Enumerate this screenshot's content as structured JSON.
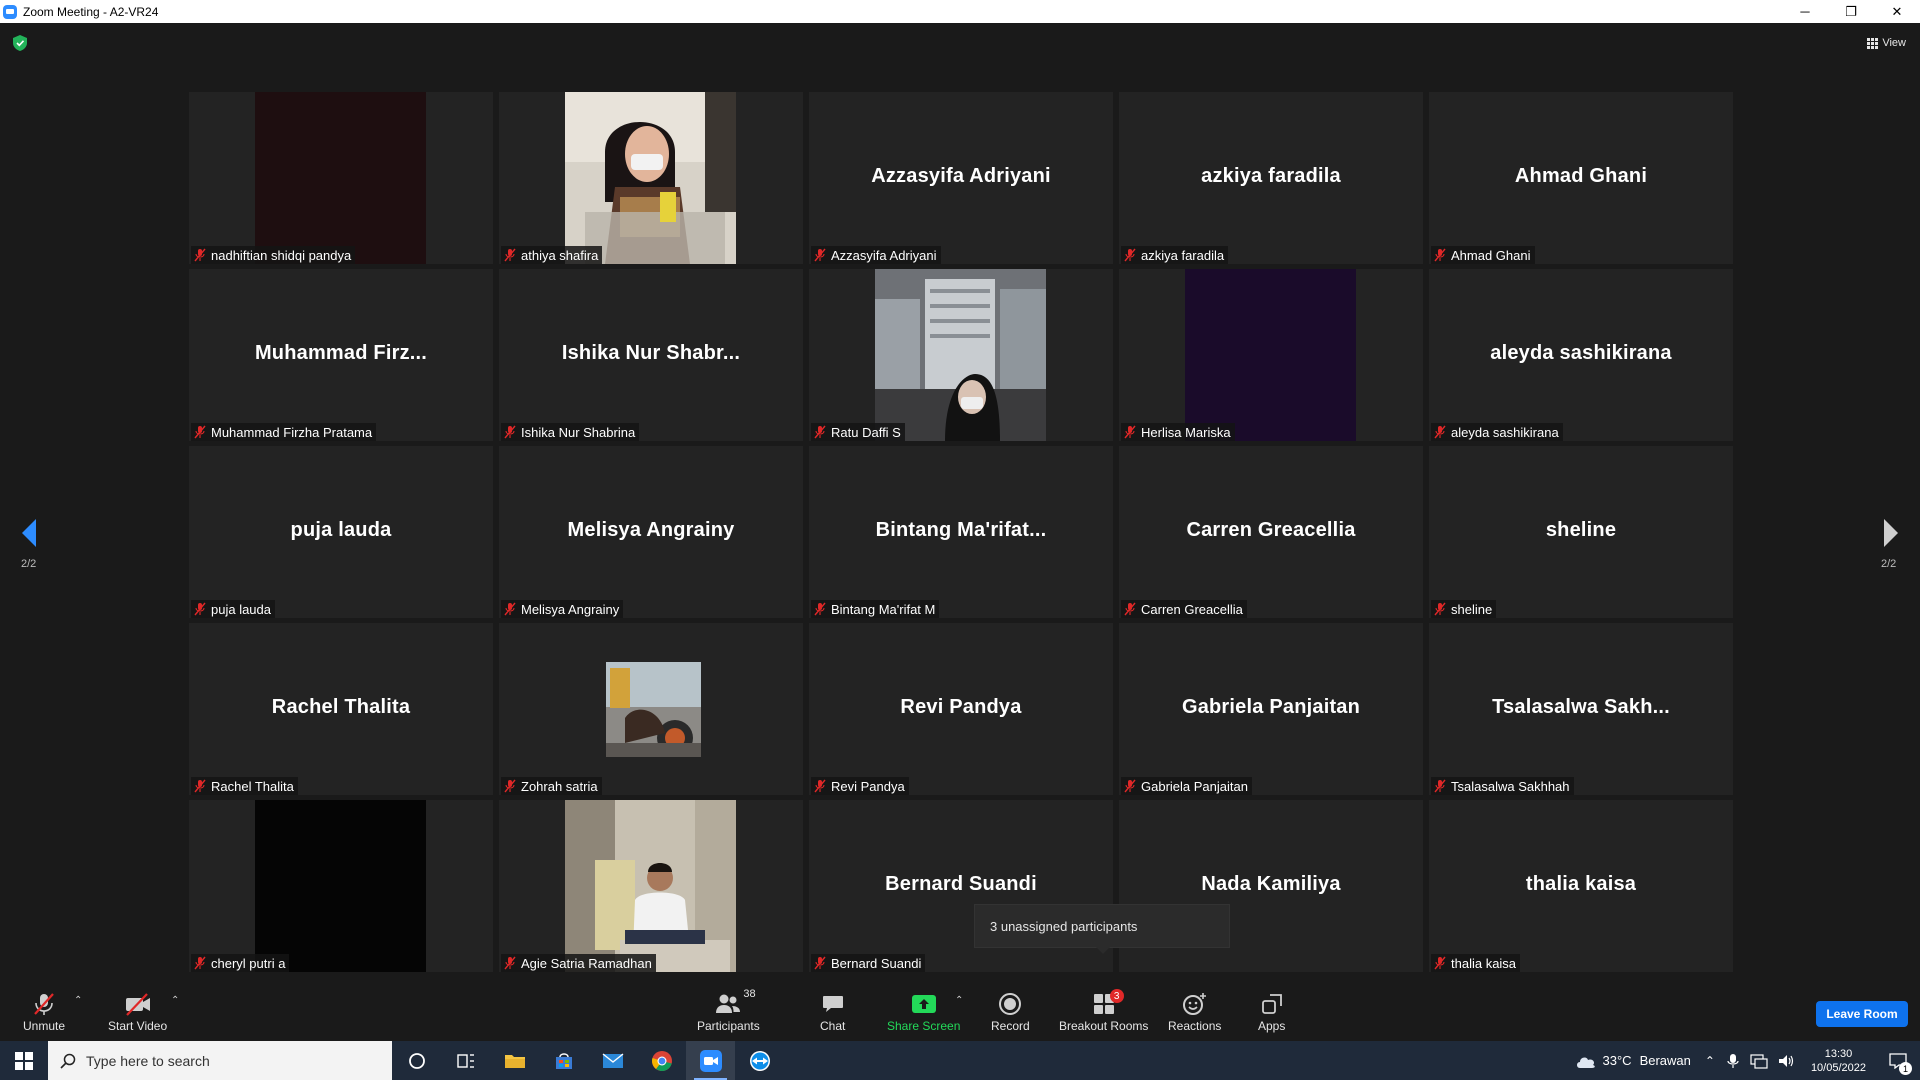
{
  "window": {
    "title": "Zoom Meeting - A2-VR24",
    "minimize": "─",
    "maximize": "❐",
    "close": "✕"
  },
  "header": {
    "view_label": "View"
  },
  "pagination": {
    "left": "2/2",
    "right": "2/2"
  },
  "participants": [
    {
      "name": "nadhiftian shidqi pandya",
      "display": "",
      "video": "dark"
    },
    {
      "name": "athiya shafira",
      "display": "",
      "video": "person"
    },
    {
      "name": "Azzasyifa Adriyani",
      "display": "Azzasyifa Adriyani",
      "video": "none"
    },
    {
      "name": "azkiya faradila",
      "display": "azkiya faradila",
      "video": "none"
    },
    {
      "name": "Ahmad Ghani",
      "display": "Ahmad Ghani",
      "video": "none"
    },
    {
      "name": "Muhammad Firzha Pratama",
      "display": "Muhammad  Firz...",
      "video": "none"
    },
    {
      "name": "Ishika Nur Shabrina",
      "display": "Ishika  Nur  Shabr...",
      "video": "none"
    },
    {
      "name": "Ratu Daffi S",
      "display": "",
      "video": "city"
    },
    {
      "name": "Herlisa Mariska",
      "display": "",
      "video": "purple"
    },
    {
      "name": "aleyda sashikirana",
      "display": "aleyda sashikirana",
      "video": "none"
    },
    {
      "name": "puja lauda",
      "display": "puja lauda",
      "video": "none"
    },
    {
      "name": "Melisya Angrainy",
      "display": "Melisya Angrainy",
      "video": "none"
    },
    {
      "name": "Bintang Ma'rifat M",
      "display": "Bintang  Ma'rifat...",
      "video": "none"
    },
    {
      "name": "Carren Greacellia",
      "display": "Carren Greacellia",
      "video": "none"
    },
    {
      "name": "sheline",
      "display": "sheline",
      "video": "none"
    },
    {
      "name": "Rachel Thalita",
      "display": "Rachel Thalita",
      "video": "none"
    },
    {
      "name": "Zohrah satria",
      "display": "",
      "video": "avatar"
    },
    {
      "name": "Revi Pandya",
      "display": "Revi Pandya",
      "video": "none"
    },
    {
      "name": "Gabriela Panjaitan",
      "display": "Gabriela Panjaitan",
      "video": "none"
    },
    {
      "name": "Tsalasalwa Sakhhah",
      "display": "Tsalasalwa  Sakh...",
      "video": "none"
    },
    {
      "name": "cheryl putri a",
      "display": "",
      "video": "black"
    },
    {
      "name": "Agie Satria Ramadhan",
      "display": "",
      "video": "room"
    },
    {
      "name": "Bernard Suandi",
      "display": "Bernard Suandi",
      "video": "none"
    },
    {
      "name": "Nada Kamiliya",
      "display": "Nada Kamiliya",
      "video": "none-noname"
    },
    {
      "name": "thalia kaisa",
      "display": "thalia kaisa",
      "video": "none"
    }
  ],
  "tooltip": {
    "text": "3 unassigned participants"
  },
  "toolbar": {
    "unmute": "Unmute",
    "start_video": "Start Video",
    "participants": "Participants",
    "participants_count": "38",
    "chat": "Chat",
    "share_screen": "Share Screen",
    "record": "Record",
    "breakout_rooms": "Breakout Rooms",
    "breakout_badge": "3",
    "reactions": "Reactions",
    "apps": "Apps",
    "leave": "Leave Room"
  },
  "taskbar": {
    "search_placeholder": "Type here to search",
    "temperature": "33°C",
    "weather": "Berawan",
    "time": "13:30",
    "date": "10/05/2022",
    "notification_count": "1"
  },
  "colors": {
    "accent": "#0e72ed",
    "share_green": "#23d959",
    "mute_red": "#e02828",
    "tile_bg": "#232323"
  }
}
